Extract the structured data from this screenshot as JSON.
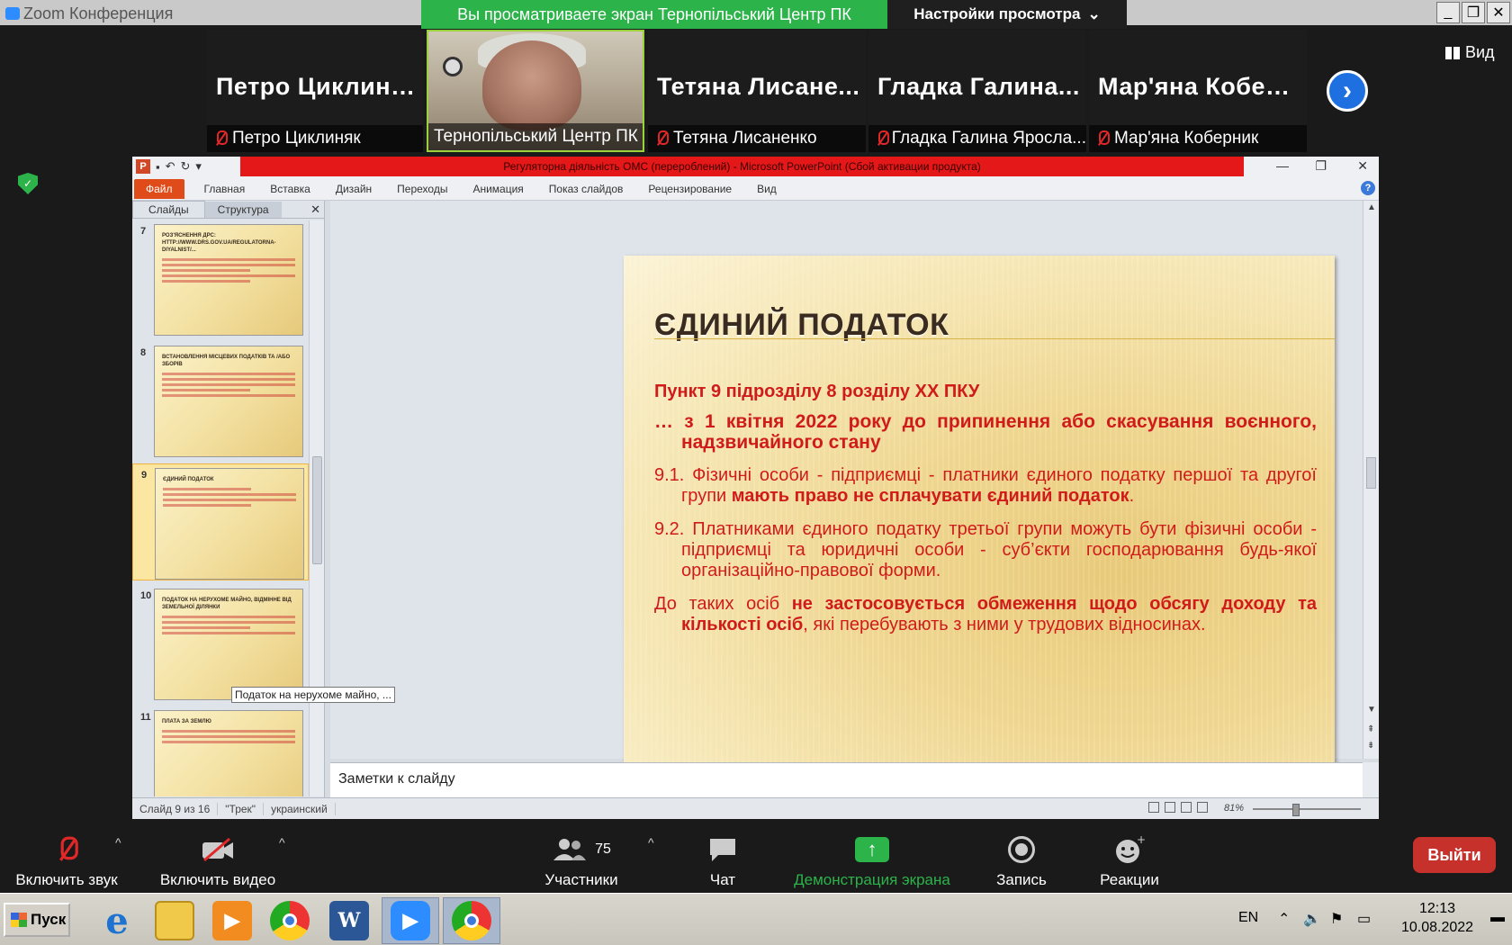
{
  "zoom": {
    "app_title": "Zoom Конференция",
    "share_banner": "Вы просматриваете экран Тернопільський Центр ПК",
    "view_settings": "Настройки просмотра",
    "view_button": "Вид",
    "colors": {
      "banner": "#2cb34a",
      "exit": "#c7312c",
      "accent": "#1e6fe0"
    }
  },
  "participants": [
    {
      "big_name": "Петро Циклиняк",
      "label": "Петро Циклиняк",
      "muted": true
    },
    {
      "big_name": "",
      "label": "Тернопільський Центр ПК",
      "muted": false,
      "video": true
    },
    {
      "big_name": "Тетяна Лисане...",
      "label": "Тетяна Лисаненко",
      "muted": true
    },
    {
      "big_name": "Гладка Галина...",
      "label": "Гладка Галина Яросла...",
      "muted": true
    },
    {
      "big_name": "Мар'яна Кобер...",
      "label": "Мар'яна Коберник",
      "muted": true
    }
  ],
  "powerpoint": {
    "title": "Регуляторна діяльність ОМС (перероблений)  -  Microsoft PowerPoint (Сбой активации продукта)",
    "tabs": [
      "Файл",
      "Главная",
      "Вставка",
      "Дизайн",
      "Переходы",
      "Анимация",
      "Показ слайдов",
      "Рецензирование",
      "Вид"
    ],
    "side_tabs": [
      "Слайды",
      "Структура"
    ],
    "thumbnails": [
      {
        "num": "7",
        "title": "РОЗ'ЯСНЕННЯ ДРС: HTTP://WWW.DRS.GOV.UA/REGULATORNA-DIYALNIST/..."
      },
      {
        "num": "8",
        "title": "ВСТАНОВЛЕННЯ МІСЦЕВИХ ПОДАТКІВ ТА /АБО ЗБОРІВ"
      },
      {
        "num": "9",
        "title": "ЄДИНИЙ ПОДАТОК",
        "selected": true
      },
      {
        "num": "10",
        "title": "ПОДАТОК НА НЕРУХОМЕ МАЙНО, ВІДМІННЕ ВІД ЗЕМЕЛЬНОЇ ДІЛЯНКИ"
      },
      {
        "num": "11",
        "title": "ПЛАТА ЗА ЗЕМЛЮ"
      }
    ],
    "tooltip": "Податок на нерухоме майно, ...",
    "slide": {
      "heading": "ЄДИНИЙ ПОДАТОК",
      "p1": "Пункт 9 підрозділу 8 розділу XX ПКУ",
      "p2": "… з 1 квітня 2022 року до припинення або скасування воєнного, надзвичайного стану",
      "p3_a": "9.1. Фізичні особи - підприємці - платники єдиного податку першої та другої групи ",
      "p3_b": "мають право не сплачувати єдиний податок",
      "p3_c": ".",
      "p4": "9.2. Платниками єдиного податку третьої групи можуть бути фізичні особи - підприємці та юридичні особи - суб’єкти господарювання будь-якої організаційно-правової форми.",
      "p5_a": "До таких осіб ",
      "p5_b": "не застосовується обмеження щодо обсягу доходу та кількості осіб",
      "p5_c": ", які перебувають з ними у трудових відносинах."
    },
    "notes_placeholder": "Заметки к слайду",
    "status": {
      "slide": "Слайд 9 из 16",
      "theme": "\"Трек\"",
      "language": "украинский",
      "zoom": "81%"
    }
  },
  "toolbar": {
    "unmute": "Включить звук",
    "video": "Включить видео",
    "participants": "Участники",
    "participants_count": "75",
    "chat": "Чат",
    "share": "Демонстрация экрана",
    "record": "Запись",
    "reactions": "Реакции",
    "exit": "Выйти"
  },
  "taskbar": {
    "start": "Пуск",
    "lang": "EN",
    "time": "12:13",
    "date": "10.08.2022"
  }
}
